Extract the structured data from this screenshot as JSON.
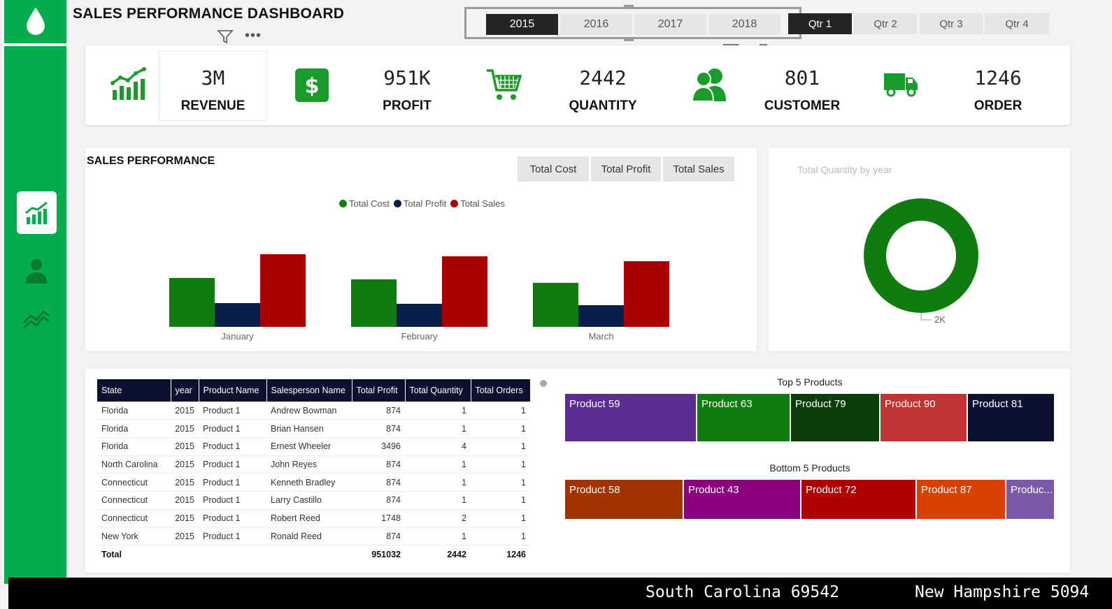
{
  "header": {
    "title": "SALES PERFORMANCE DASHBOARD"
  },
  "slicers": {
    "years": [
      "2015",
      "2016",
      "2017",
      "2018"
    ],
    "selected_year": "2015",
    "quarters": [
      "Qtr 1",
      "Qtr 2",
      "Qtr 3",
      "Qtr 4"
    ],
    "selected_quarter": "Qtr 1"
  },
  "kpis": [
    {
      "value": "3M",
      "label": "REVENUE",
      "icon": "growth-chart-icon"
    },
    {
      "value": "951K",
      "label": "PROFIT",
      "icon": "dollar-icon"
    },
    {
      "value": "2442",
      "label": "QUANTITY",
      "icon": "cart-icon"
    },
    {
      "value": "801",
      "label": "CUSTOMER",
      "icon": "users-icon"
    },
    {
      "value": "1246",
      "label": "ORDER",
      "icon": "truck-icon"
    }
  ],
  "sales_performance": {
    "title": "SALES PERFORMANCE",
    "tabs": [
      "Total Cost",
      "Total Profit",
      "Total Sales"
    ]
  },
  "donut": {
    "title": "Total Quantity by year",
    "label": "2K"
  },
  "colors": {
    "cost": "#107c10",
    "profit": "#0a1e4a",
    "sales": "#a80000",
    "brand": "#05ac4c"
  },
  "chart_data": [
    {
      "type": "bar",
      "categories": [
        "January",
        "February",
        "March"
      ],
      "series": [
        {
          "name": "Total Cost",
          "values": [
            70,
            68,
            63
          ]
        },
        {
          "name": "Total Profit",
          "values": [
            34,
            33,
            31
          ]
        },
        {
          "name": "Total Sales",
          "values": [
            104,
            101,
            94
          ]
        }
      ],
      "legend": "top-center",
      "grid": false
    },
    {
      "type": "pie",
      "categories": [
        "2015"
      ],
      "values": [
        2442
      ],
      "labels": [
        "2K"
      ]
    }
  ],
  "table": {
    "columns": [
      "State",
      "year",
      "Product Name",
      "Salesperson Name",
      "Total Profit",
      "Total Quantity",
      "Total Orders"
    ],
    "rows": [
      [
        "Florida",
        "2015",
        "Product 1",
        "Andrew Bowman",
        "874",
        "1",
        "1"
      ],
      [
        "Florida",
        "2015",
        "Product 1",
        "Brian Hansen",
        "874",
        "1",
        "1"
      ],
      [
        "Florida",
        "2015",
        "Product 1",
        "Ernest Wheeler",
        "3496",
        "4",
        "1"
      ],
      [
        "North Carolina",
        "2015",
        "Product 1",
        "John Reyes",
        "874",
        "1",
        "1"
      ],
      [
        "Connecticut",
        "2015",
        "Product 1",
        "Kenneth Bradley",
        "874",
        "1",
        "1"
      ],
      [
        "Connecticut",
        "2015",
        "Product 1",
        "Larry Castillo",
        "874",
        "1",
        "1"
      ],
      [
        "Connecticut",
        "2015",
        "Product 1",
        "Robert Reed",
        "1748",
        "2",
        "1"
      ],
      [
        "New York",
        "2015",
        "Product 1",
        "Ronald Reed",
        "874",
        "1",
        "1"
      ]
    ],
    "total": [
      "Total",
      "",
      "",
      "",
      "951032",
      "2442",
      "1246"
    ]
  },
  "top_products": {
    "title": "Top 5 Products",
    "items": [
      {
        "name": "Product 59",
        "color": "#5c2d91"
      },
      {
        "name": "Product 63",
        "color": "#107c10"
      },
      {
        "name": "Product 79",
        "color": "#0b3d0b"
      },
      {
        "name": "Product 90",
        "color": "#c03434"
      },
      {
        "name": "Product 81",
        "color": "#0a1230"
      }
    ]
  },
  "bottom_products": {
    "title": "Bottom  5 Products",
    "items": [
      {
        "name": "Product 58",
        "color": "#a33400"
      },
      {
        "name": "Product 43",
        "color": "#8a0080"
      },
      {
        "name": "Product 72",
        "color": "#b00000"
      },
      {
        "name": "Product 87",
        "color": "#d84100"
      },
      {
        "name": "Produc...",
        "color": "#7a5aa8"
      }
    ]
  },
  "ticker": [
    "South Carolina 69542",
    "New Hampshire 5094"
  ]
}
